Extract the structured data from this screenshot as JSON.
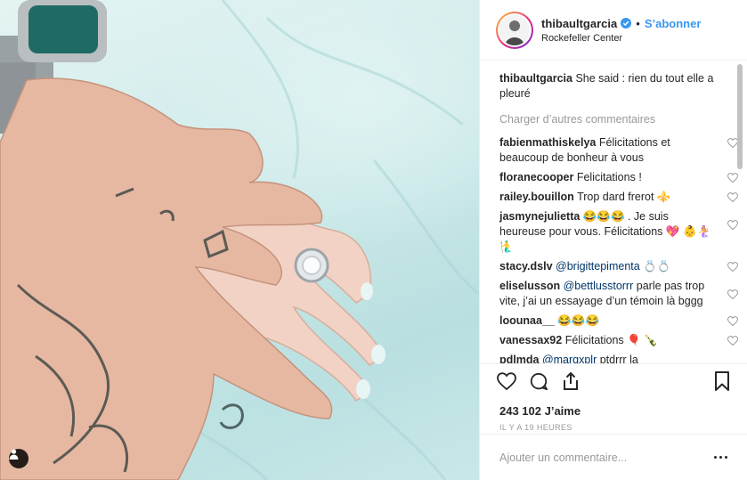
{
  "post": {
    "author": "thibaultgarcia",
    "follow_label": "S’abonner",
    "separator": "•",
    "location": "Rockefeller Center"
  },
  "caption": {
    "username": "thibaultgarcia",
    "text": "She said : rien du tout elle a pleuré"
  },
  "load_more_label": "Charger d’autres commentaires",
  "comments": [
    {
      "username": "fabienmathiskelya",
      "text": "Félicitations et beaucoup de bonheur à vous"
    },
    {
      "username": "floranecooper",
      "text": "Felicitations !"
    },
    {
      "username": "railey.bouillon",
      "text": "Trop dard frerot ⚜️"
    },
    {
      "username": "jasmynejulietta",
      "text": "😂😂😂 . Je suis heureuse pour vous. Félicitations 💖 👶🧜‍♀️🧜‍♂️"
    },
    {
      "username": "stacy.dslv",
      "mention": "@brigittepimenta",
      "text": "💍💍"
    },
    {
      "username": "eliselusson",
      "mention": "@bettlusstorrr",
      "text": "parle pas trop vite, j’ai un essayage d’un témoin là bggg"
    },
    {
      "username": "loounaa__",
      "text": "😂😂😂"
    },
    {
      "username": "vanessax92",
      "text": "Félicitations 🎈 🍾"
    },
    {
      "username": "pdlmda",
      "mention": "@marqxplr",
      "text": "ptdrrr la"
    }
  ],
  "likes_text": "243 102 J’aime",
  "time_text": "IL Y A 19 HEURES",
  "add_comment_placeholder": "Ajouter un commentaire...",
  "colors": {
    "accent": "#3897f0",
    "verified": "#3897f0",
    "text": "#262626",
    "muted": "#999999"
  },
  "icons": {
    "verified": "verified-badge-icon",
    "like": "heart-icon",
    "comment": "comment-bubble-icon",
    "share": "share-icon",
    "save": "bookmark-icon",
    "user_tag": "person-tag-icon",
    "more": "more-options-icon"
  }
}
